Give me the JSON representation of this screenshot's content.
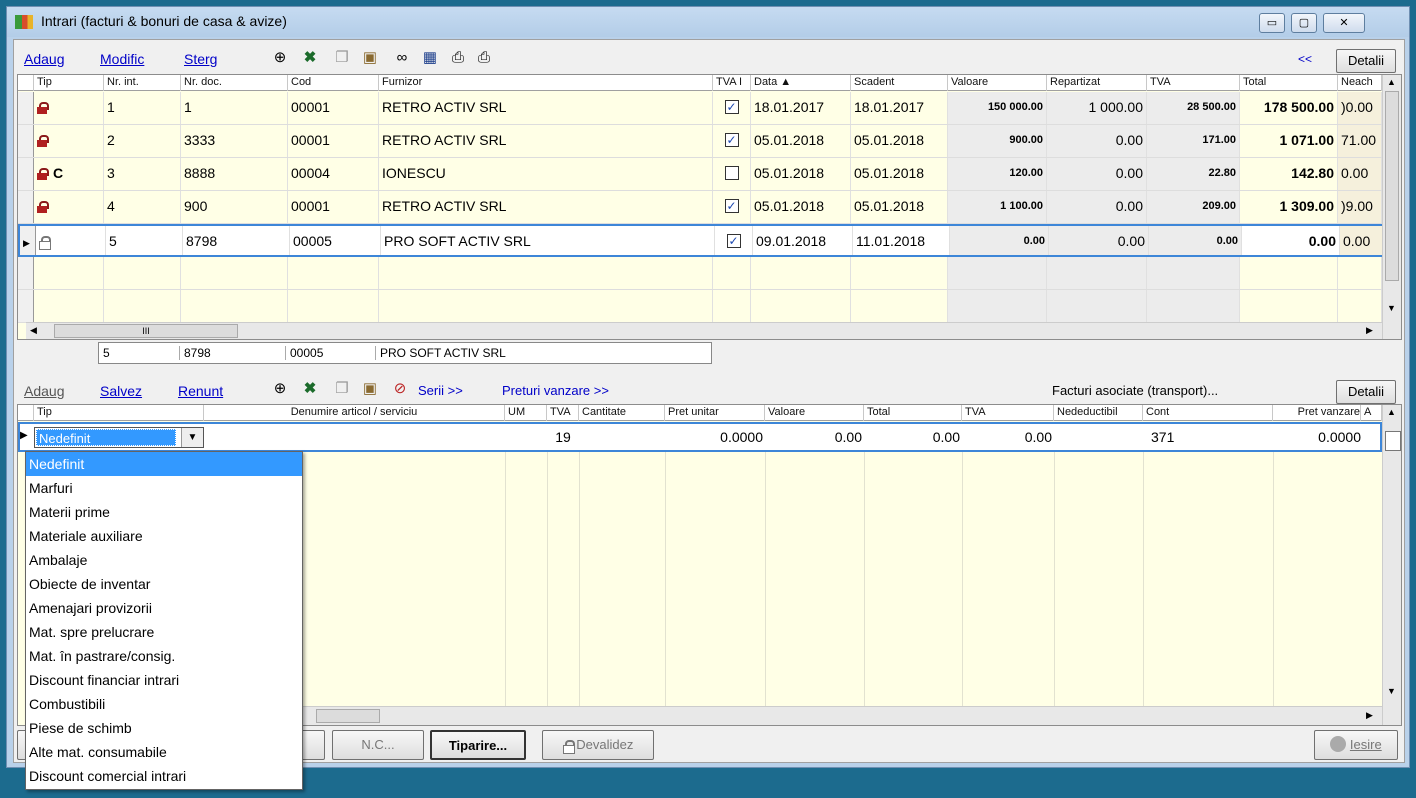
{
  "window": {
    "title": "Intrari (facturi & bonuri de casa & avize)",
    "min": "▭",
    "max": "▢",
    "close": "✕"
  },
  "toolbar": {
    "add": "Adaug",
    "modify": "Modific",
    "delete": "Sterg",
    "collapse": "<<",
    "details": "Detalii"
  },
  "table": {
    "headers": [
      "Tip",
      "Nr. int.",
      "Nr. doc.",
      "Cod",
      "Furnizor",
      "TVA I",
      "Data ▲",
      "Scadent",
      "Valoare",
      "Repartizat",
      "TVA",
      "Total",
      "Neach"
    ],
    "rows": [
      {
        "tip": "",
        "nr_int": "1",
        "nr_doc": "1",
        "cod": "00001",
        "furnizor": "RETRO ACTIV SRL",
        "tva_i": true,
        "data": "18.01.2017",
        "scadent": "18.01.2017",
        "valoare": "150 000.00",
        "repartizat": "1 000.00",
        "tva": "28 500.00",
        "total": "178 500.00",
        "neach": ")0.00",
        "locked": true
      },
      {
        "tip": "",
        "nr_int": "2",
        "nr_doc": "3333",
        "cod": "00001",
        "furnizor": "RETRO ACTIV SRL",
        "tva_i": true,
        "data": "05.01.2018",
        "scadent": "05.01.2018",
        "valoare": "900.00",
        "repartizat": "0.00",
        "tva": "171.00",
        "total": "1 071.00",
        "neach": "71.00",
        "locked": true
      },
      {
        "tip": "C",
        "nr_int": "3",
        "nr_doc": "8888",
        "cod": "00004",
        "furnizor": "IONESCU",
        "tva_i": false,
        "data": "05.01.2018",
        "scadent": "05.01.2018",
        "valoare": "120.00",
        "repartizat": "0.00",
        "tva": "22.80",
        "total": "142.80",
        "neach": "0.00",
        "locked": true
      },
      {
        "tip": "",
        "nr_int": "4",
        "nr_doc": "900",
        "cod": "00001",
        "furnizor": "RETRO ACTIV SRL",
        "tva_i": true,
        "data": "05.01.2018",
        "scadent": "05.01.2018",
        "valoare": "1 100.00",
        "repartizat": "0.00",
        "tva": "209.00",
        "total": "1 309.00",
        "neach": ")9.00",
        "locked": true
      },
      {
        "tip": "",
        "nr_int": "5",
        "nr_doc": "8798",
        "cod": "00005",
        "furnizor": "PRO SOFT ACTIV SRL",
        "tva_i": true,
        "data": "09.01.2018",
        "scadent": "11.01.2018",
        "valoare": "0.00",
        "repartizat": "0.00",
        "tva": "0.00",
        "total": "0.00",
        "neach": "0.00",
        "locked": false
      }
    ]
  },
  "summary": {
    "nr_int": "5",
    "nr_doc": "8798",
    "cod": "00005",
    "furnizor": "PRO SOFT ACTIV SRL"
  },
  "toolbar2": {
    "add": "Adaug",
    "save": "Salvez",
    "cancel": "Renunt",
    "series": "Serii >>",
    "prices": "Preturi vanzare >>",
    "assoc": "Facturi asociate (transport)...",
    "details": "Detalii"
  },
  "detail": {
    "headers": [
      "Tip",
      "Denumire articol / serviciu",
      "UM",
      "TVA",
      "Cantitate",
      "Pret unitar",
      "Valoare",
      "Total",
      "TVA",
      "Nedeductibil",
      "Cont",
      "Pret vanzare",
      "A"
    ],
    "row": {
      "tip": "Nedefinit",
      "tva": "19",
      "pret": "0.0000",
      "valoare": "0.00",
      "total": "0.00",
      "tva_val": "0.00",
      "cont": "371",
      "pret_vanzare": "0.0000"
    }
  },
  "dropdown": [
    "Nedefinit",
    "Marfuri",
    "Materii prime",
    "Materiale auxiliare",
    "Ambalaje",
    "Obiecte de inventar",
    "Amenajari provizorii",
    "Mat. spre prelucrare",
    "Mat. în pastrare/consig.",
    "Discount financiar intrari",
    "Combustibili",
    "Piese de schimb",
    "Alte mat. consumabile",
    "Discount comercial intrari"
  ],
  "bottom": {
    "nc": "N.C...",
    "print": "Tiparire...",
    "unvalidate": "Devalidez",
    "exit": "Iesire"
  },
  "scroll": {
    "grip": "III"
  }
}
